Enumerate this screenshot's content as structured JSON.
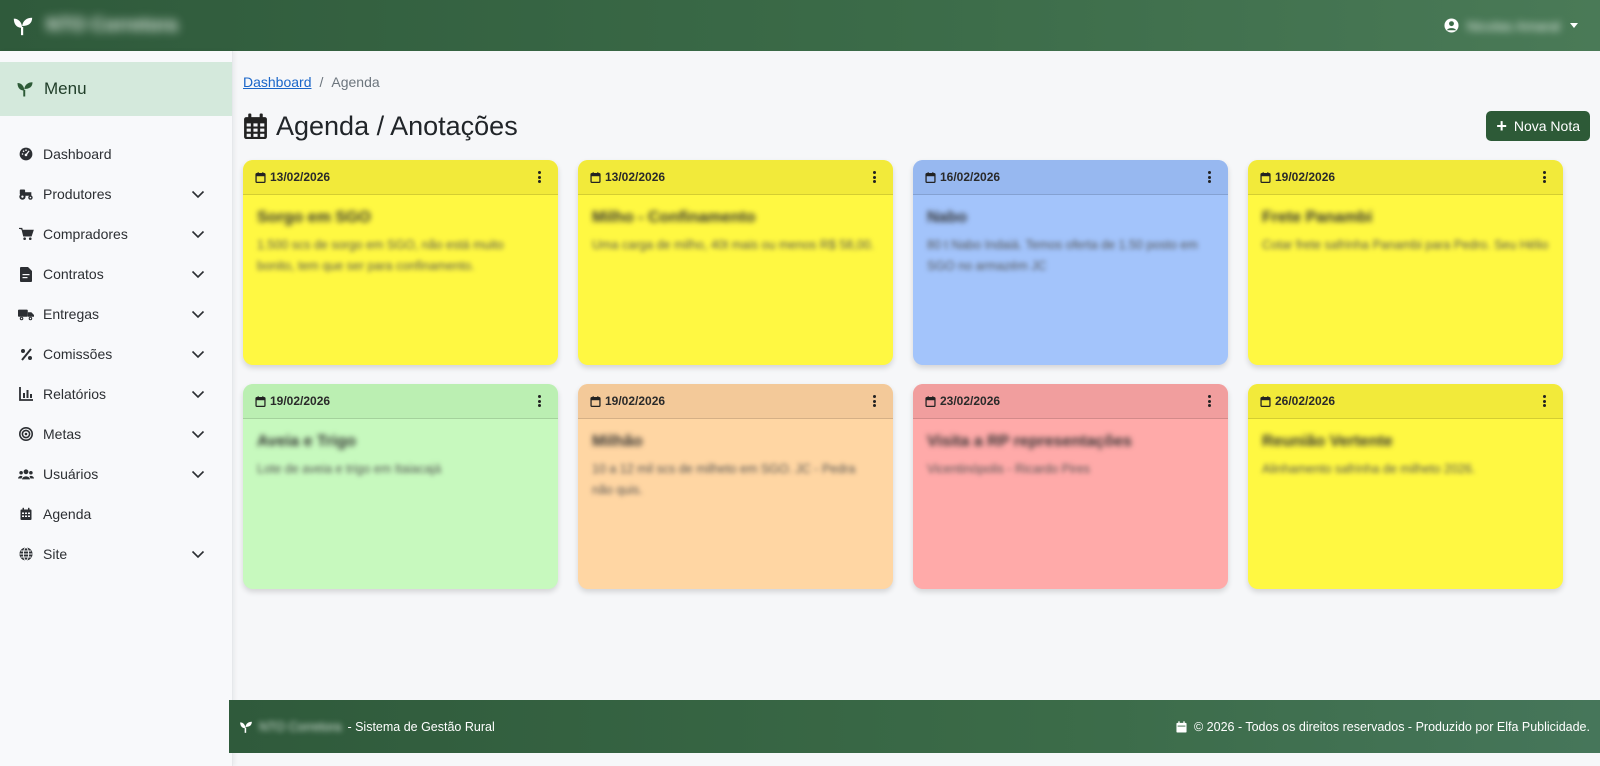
{
  "topbar": {
    "brand_name": "NTO Corretora",
    "brand_icon": "seedling-icon",
    "user_name": "Nicolas Amaral",
    "user_icon": "user-circle-icon"
  },
  "sidebar": {
    "header_label": "Menu",
    "items": [
      {
        "label": "Dashboard",
        "icon": "gauge-icon",
        "has_submenu": false
      },
      {
        "label": "Produtores",
        "icon": "tractor-icon",
        "has_submenu": true
      },
      {
        "label": "Compradores",
        "icon": "cart-icon",
        "has_submenu": true
      },
      {
        "label": "Contratos",
        "icon": "contract-icon",
        "has_submenu": true
      },
      {
        "label": "Entregas",
        "icon": "truck-icon",
        "has_submenu": true
      },
      {
        "label": "Comissões",
        "icon": "percent-icon",
        "has_submenu": true
      },
      {
        "label": "Relatórios",
        "icon": "chart-icon",
        "has_submenu": true
      },
      {
        "label": "Metas",
        "icon": "target-icon",
        "has_submenu": true
      },
      {
        "label": "Usuários",
        "icon": "users-icon",
        "has_submenu": true
      },
      {
        "label": "Agenda",
        "icon": "calendar-icon",
        "has_submenu": false
      },
      {
        "label": "Site",
        "icon": "globe-icon",
        "has_submenu": true
      }
    ]
  },
  "breadcrumb": {
    "link": "Dashboard",
    "separator": "/",
    "current": "Agenda"
  },
  "page": {
    "title": "Agenda / Anotações",
    "new_note_label": "Nova Nota"
  },
  "notes": [
    {
      "date": "13/02/2026",
      "title": "Sorgo em SGO",
      "text": "1.500 scs de sorgo em SGO, não está muito bonito, tem que ser para confinamento.",
      "color": "#fff842",
      "header_color": "#f2ea3a"
    },
    {
      "date": "13/02/2026",
      "title": "Milho - Confinamento",
      "text": "Uma carga de milho, 40t mais ou menos R$ 58,00.",
      "color": "#fff842",
      "header_color": "#f2ea3a"
    },
    {
      "date": "16/02/2026",
      "title": "Nabo",
      "text": "80 t Nabo Indaiá. Temos oferta de 1.50 posto em SGO no armazém JC",
      "color": "#a3c4fb",
      "header_color": "#97b8f0"
    },
    {
      "date": "19/02/2026",
      "title": "Frete Panambi",
      "text": "Cotar frete safrinha Panambi para Pedro. Seu Hélio",
      "color": "#fff842",
      "header_color": "#f2ea3a"
    },
    {
      "date": "19/02/2026",
      "title": "Aveia e Trigo",
      "text": "Lote de aveia e trigo em Itaiacajá",
      "color": "#c7f9be",
      "header_color": "#bbefb2"
    },
    {
      "date": "19/02/2026",
      "title": "Milhão",
      "text": "10 a 12 mil scs de milheto em SGO. JC - Pedra não quis.",
      "color": "#ffd6a3",
      "header_color": "#f3c999"
    },
    {
      "date": "23/02/2026",
      "title": "Visita a RP representações",
      "text": "Vicentinópolis - Ricardo Pires",
      "color": "#ffaaa9",
      "header_color": "#f19e9e"
    },
    {
      "date": "26/02/2026",
      "title": "Reunião Vertente",
      "text": "Alinhamento safrinha de milheto 2026.",
      "color": "#fff842",
      "header_color": "#f2ea3a"
    }
  ],
  "footer": {
    "brand": "NTO Corretora",
    "system_name": "- Sistema de Gestão Rural",
    "copyright": "© 2026 - Todos os direitos reservados - Produzido por Elfa Publicidade."
  }
}
